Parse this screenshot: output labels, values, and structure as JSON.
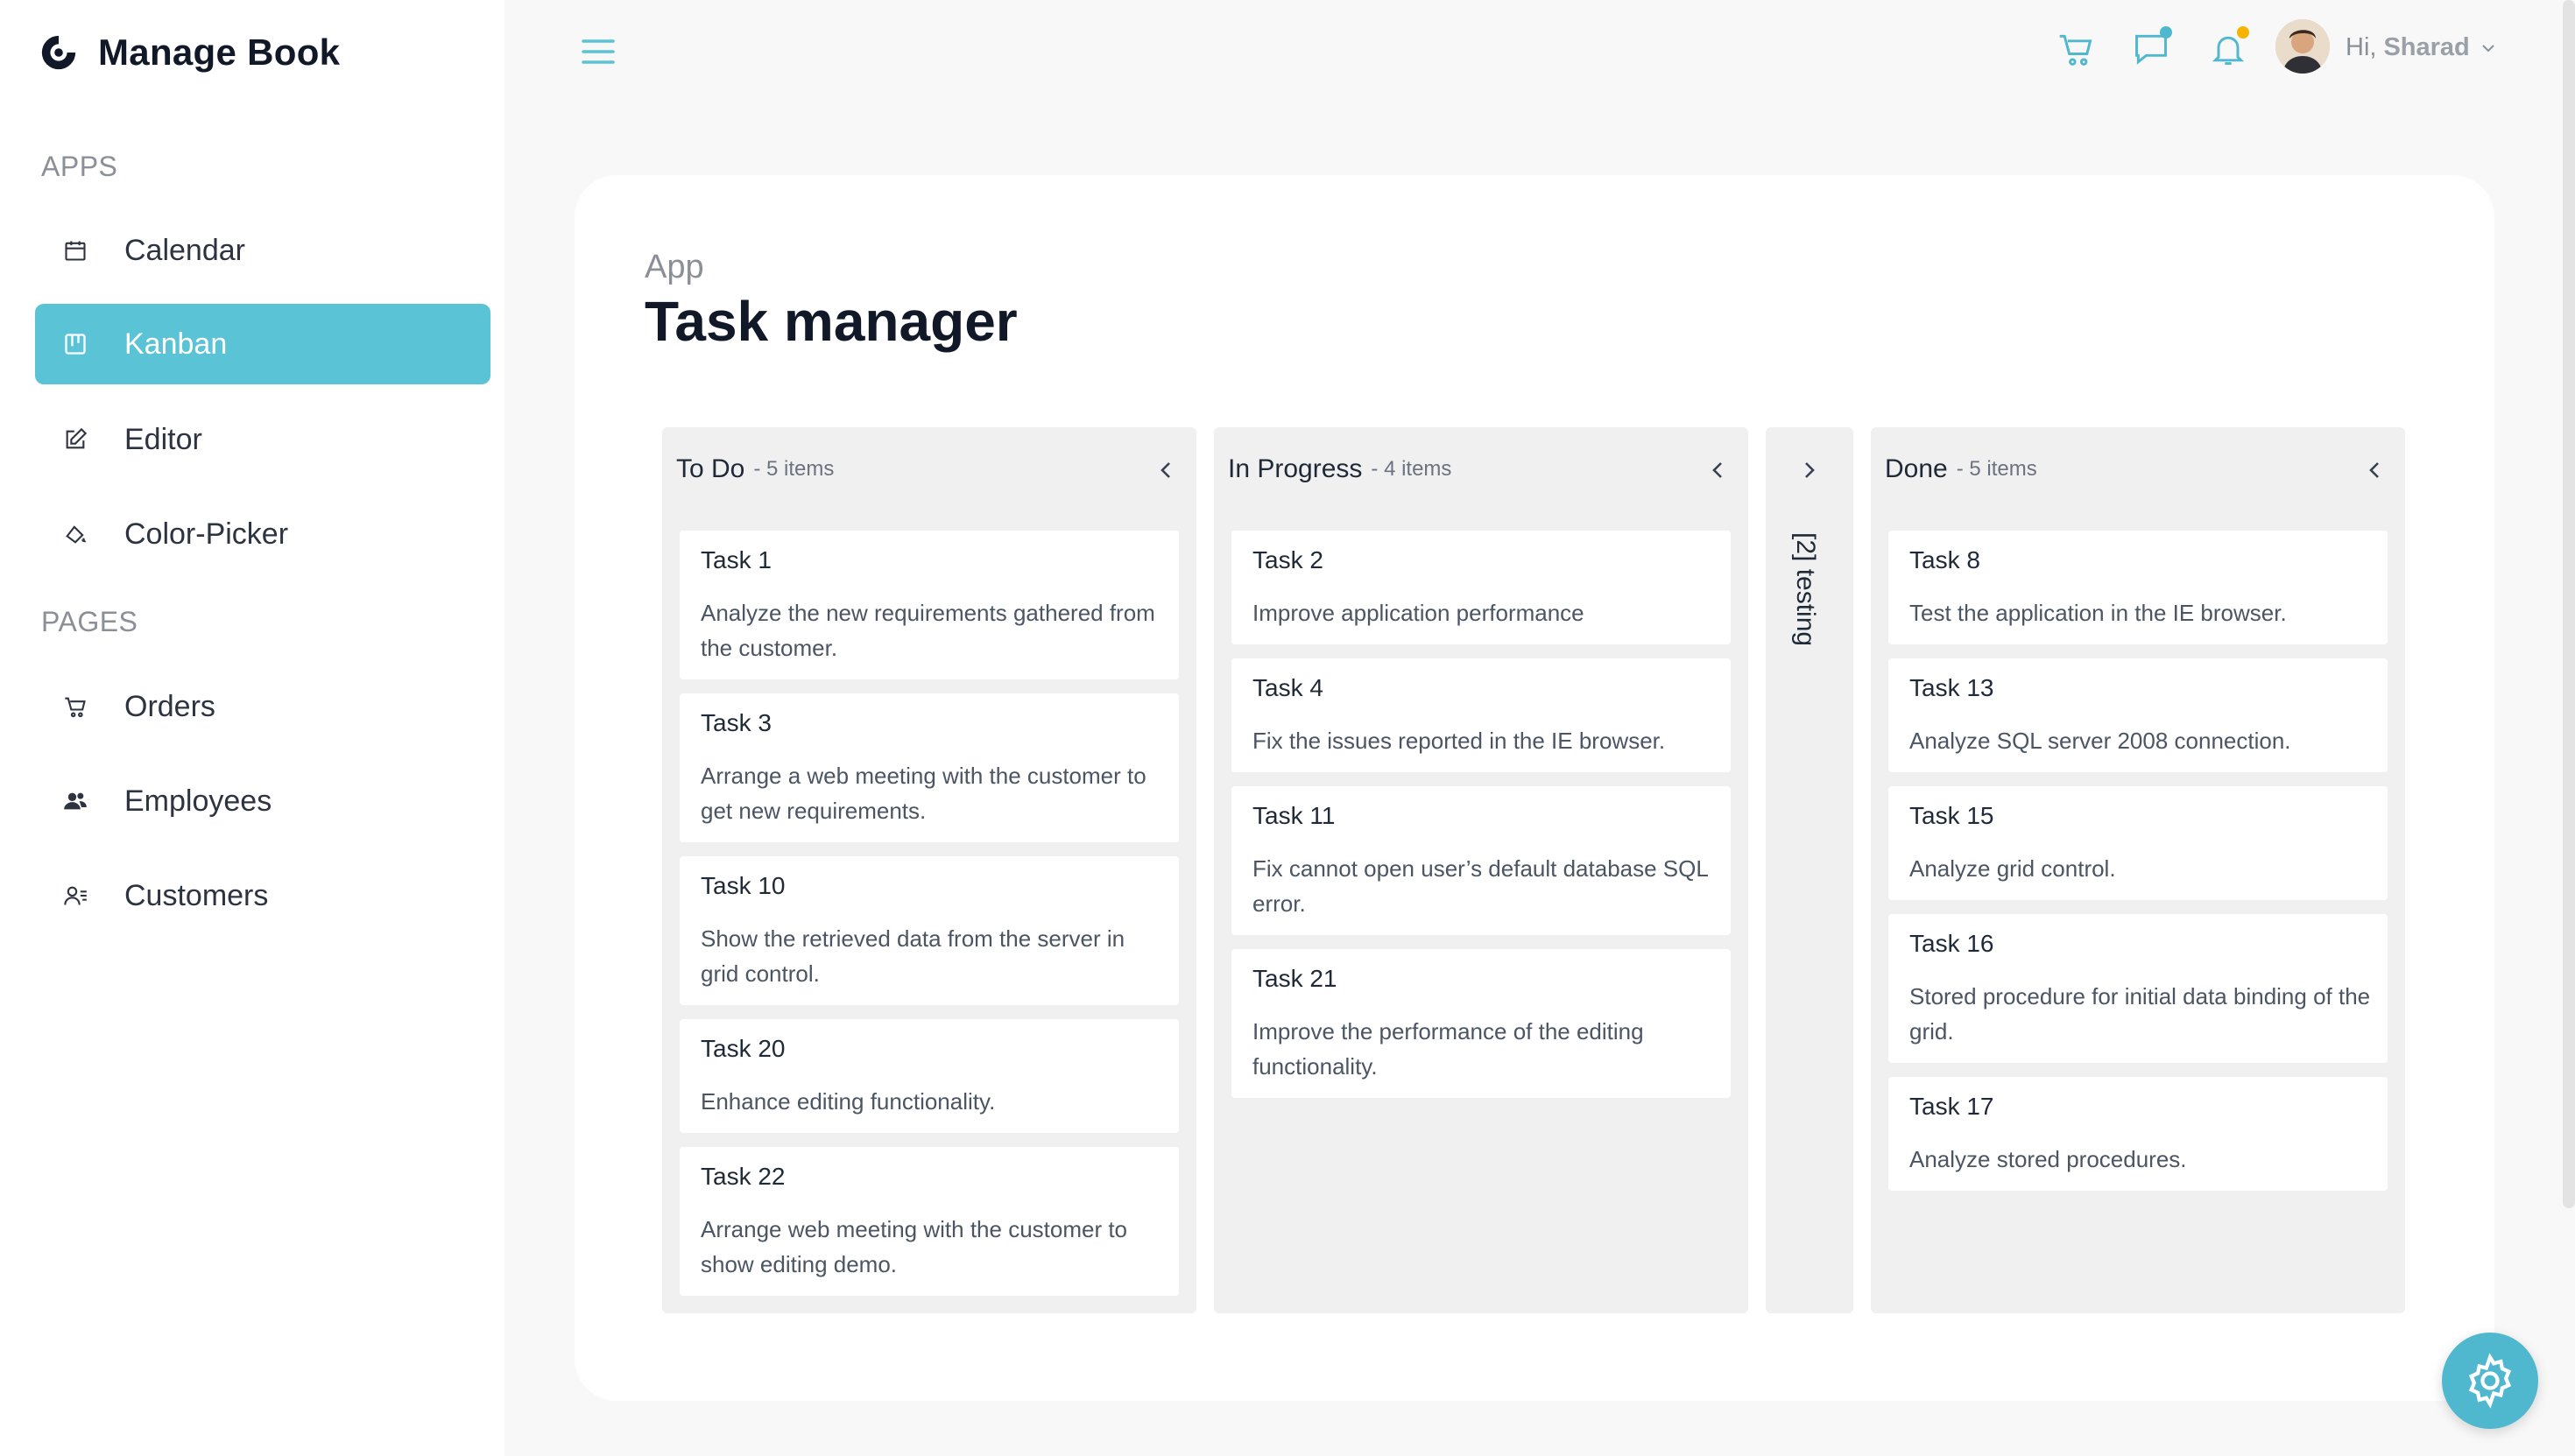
{
  "brand": {
    "name": "Manage Book"
  },
  "sidebar": {
    "sections": [
      {
        "label": "APPS",
        "items": [
          {
            "label": "Calendar",
            "icon": "calendar-icon"
          },
          {
            "label": "Kanban",
            "icon": "kanban-icon",
            "active": true
          },
          {
            "label": "Editor",
            "icon": "edit-icon"
          },
          {
            "label": "Color-Picker",
            "icon": "paint-bucket-icon"
          }
        ]
      },
      {
        "label": "PAGES",
        "items": [
          {
            "label": "Orders",
            "icon": "cart-icon"
          },
          {
            "label": "Employees",
            "icon": "users-icon"
          },
          {
            "label": "Customers",
            "icon": "customers-icon"
          }
        ]
      }
    ]
  },
  "header": {
    "greeting": "Hi,",
    "user_name": "Sharad",
    "icons": [
      "menu-icon",
      "cart-icon",
      "chat-icon",
      "bell-icon",
      "avatar",
      "chevron-down-icon"
    ]
  },
  "page": {
    "subtitle": "App",
    "title": "Task manager"
  },
  "kanban": {
    "columns": [
      {
        "title": "To Do",
        "count": "- 5 items",
        "cards": [
          {
            "title": "Task 1",
            "text": "Analyze the new requirements gathered from the customer."
          },
          {
            "title": "Task 3",
            "text": "Arrange a web meeting with the customer to get new requirements."
          },
          {
            "title": "Task 10",
            "text": "Show the retrieved data from the server in grid control."
          },
          {
            "title": "Task 20",
            "text": "Enhance editing functionality."
          },
          {
            "title": "Task 22",
            "text": "Arrange web meeting with the customer to show editing demo."
          }
        ]
      },
      {
        "title": "In Progress",
        "count": "- 4 items",
        "cards": [
          {
            "title": "Task 2",
            "text": "Improve application performance"
          },
          {
            "title": "Task 4",
            "text": "Fix the issues reported in the IE browser."
          },
          {
            "title": "Task 11",
            "text": "Fix cannot open user’s default database SQL error."
          },
          {
            "title": "Task 21",
            "text": "Improve the performance of the editing functionality."
          }
        ]
      },
      {
        "title": "Done",
        "count": "- 5 items",
        "cards": [
          {
            "title": "Task 8",
            "text": "Test the application in the IE browser."
          },
          {
            "title": "Task 13",
            "text": "Analyze SQL server 2008 connection."
          },
          {
            "title": "Task 15",
            "text": "Analyze grid control."
          },
          {
            "title": "Task 16",
            "text": "Stored procedure for initial data binding of the grid."
          },
          {
            "title": "Task 17",
            "text": "Analyze stored procedures."
          }
        ]
      }
    ],
    "collapsed": {
      "label": "[2] testing"
    }
  },
  "colors": {
    "accent": "#5bc3d6",
    "notify_blue": "#4fb8cf",
    "notify_orange": "#f5b400"
  }
}
